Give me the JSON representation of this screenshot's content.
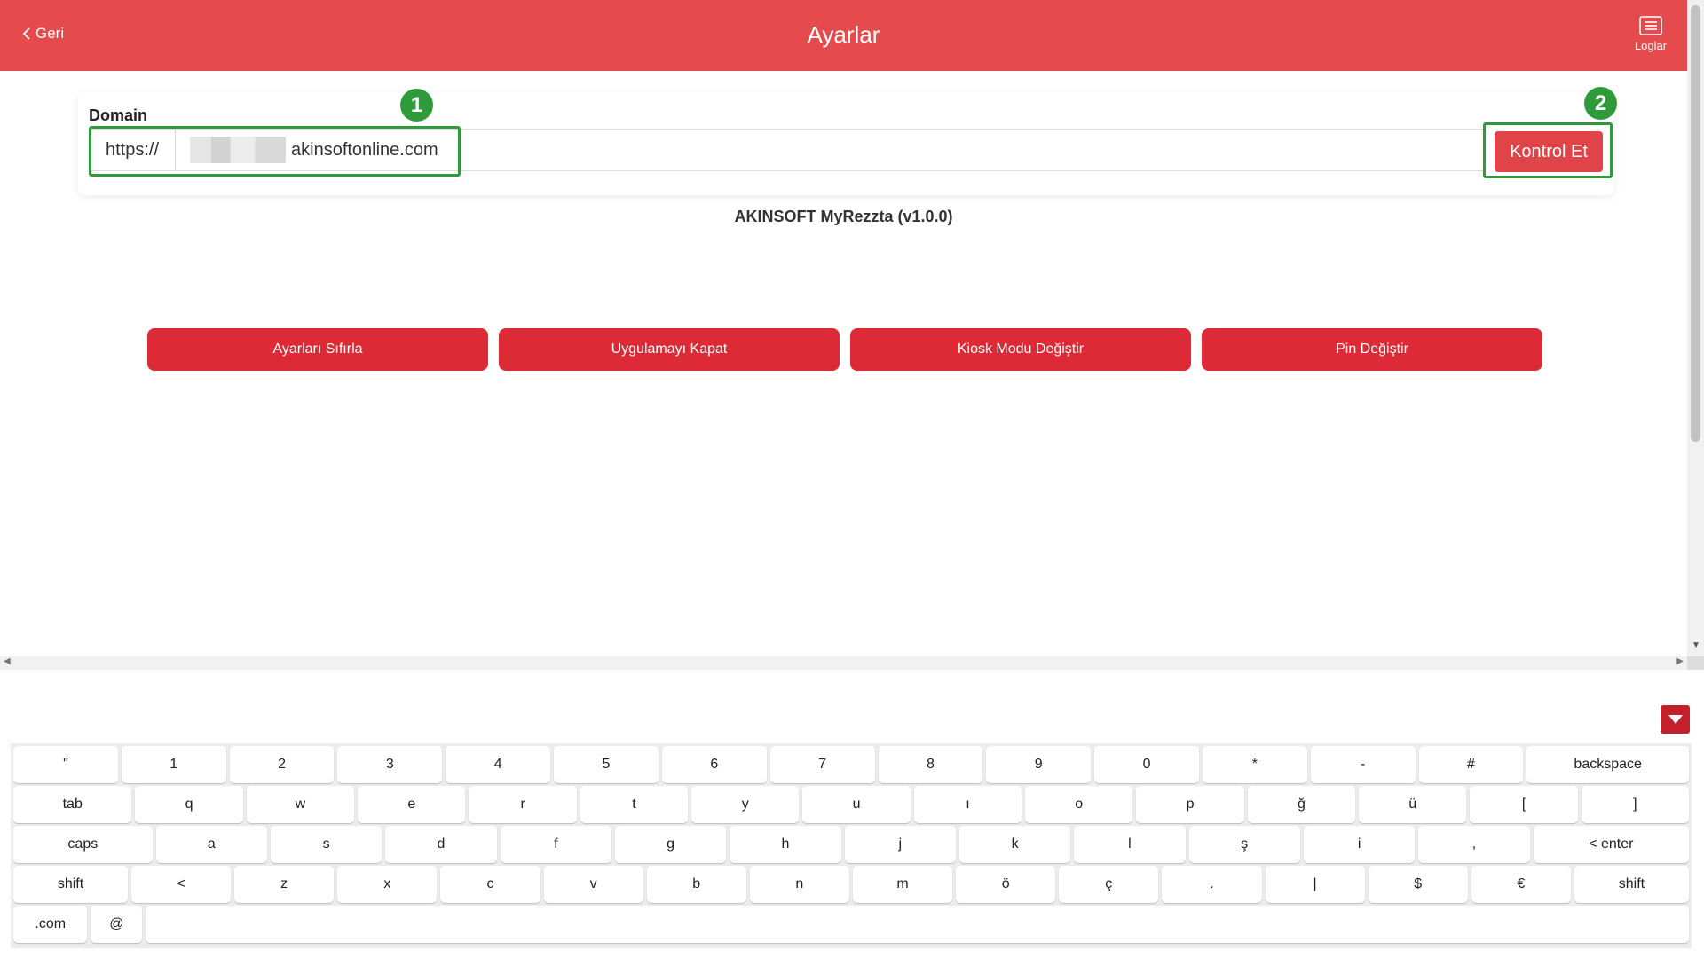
{
  "header": {
    "back_label": "Geri",
    "title": "Ayarlar",
    "logs_label": "Loglar"
  },
  "domain": {
    "label": "Domain",
    "prefix": "https://",
    "value_visible": "akinsoftonline.com",
    "check_button": "Kontrol Et"
  },
  "annotations": {
    "badge_1": "1",
    "badge_2": "2"
  },
  "version_text": "AKINSOFT MyRezzta (v1.0.0)",
  "actions": [
    {
      "label": "Ayarları Sıfırla"
    },
    {
      "label": "Uygulamayı Kapat"
    },
    {
      "label": "Kiosk Modu Değiştir"
    },
    {
      "label": "Pin Değiştir"
    }
  ],
  "keyboard": {
    "rows": [
      [
        "\"",
        "1",
        "2",
        "3",
        "4",
        "5",
        "6",
        "7",
        "8",
        "9",
        "0",
        "*",
        "-",
        "#",
        "backspace"
      ],
      [
        "tab",
        "q",
        "w",
        "e",
        "r",
        "t",
        "y",
        "u",
        "ı",
        "o",
        "p",
        "ğ",
        "ü",
        "[",
        "]"
      ],
      [
        "caps",
        "a",
        "s",
        "d",
        "f",
        "g",
        "h",
        "j",
        "k",
        "l",
        "ş",
        "i",
        ",",
        "< enter"
      ],
      [
        "shift",
        "<",
        "z",
        "x",
        "c",
        "v",
        "b",
        "n",
        "m",
        "ö",
        "ç",
        ".",
        "|",
        "$",
        "€",
        "shift"
      ],
      [
        ".com",
        "@",
        ""
      ]
    ]
  },
  "colors": {
    "header_bg": "#e54a4d",
    "action_button": "#dc2b36",
    "annotation_green": "#2e9a3a"
  }
}
